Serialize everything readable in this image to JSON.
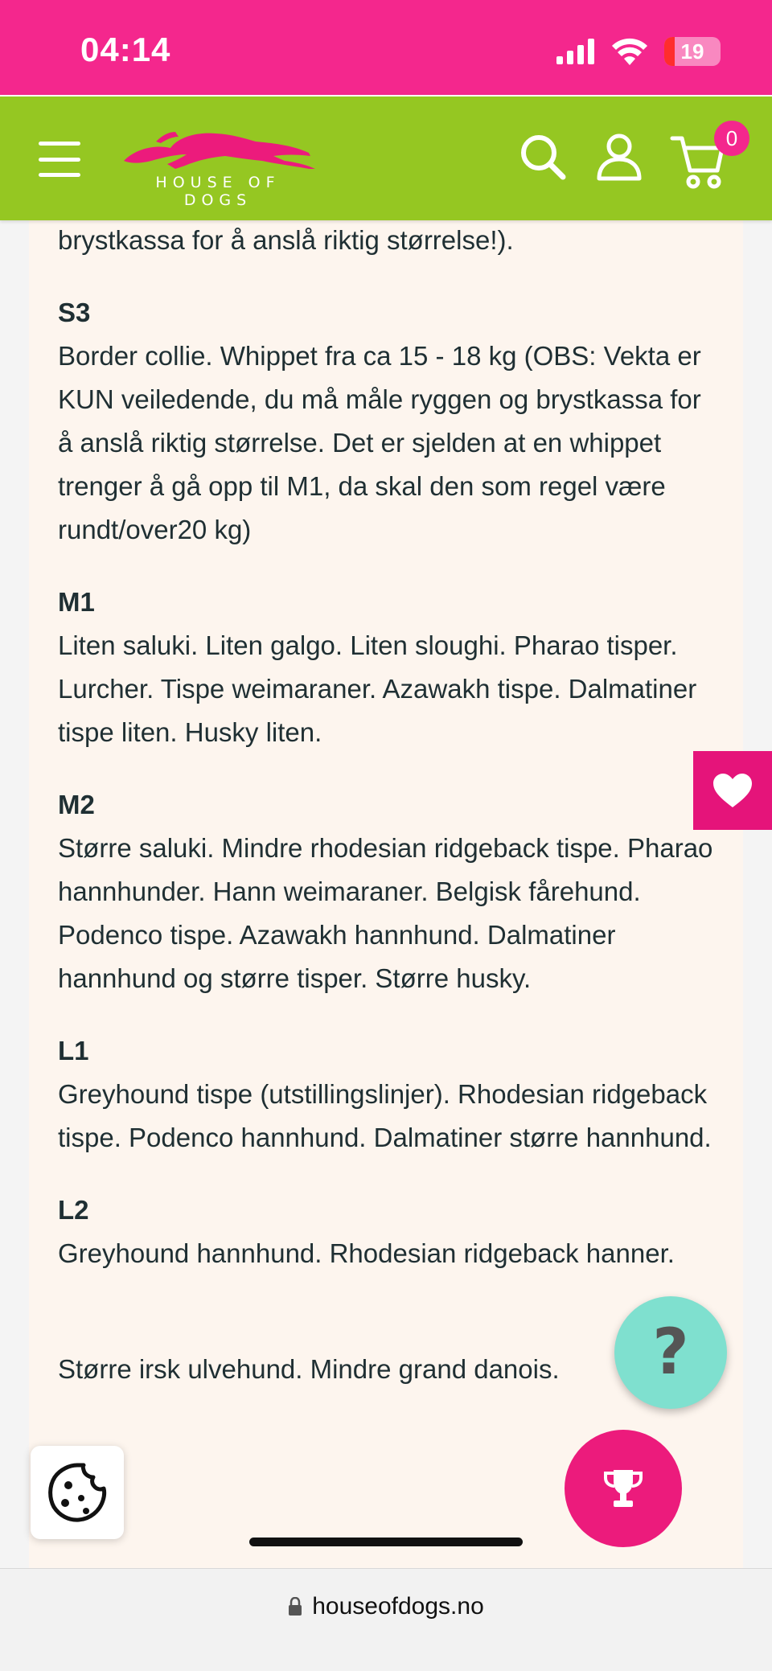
{
  "status_bar": {
    "time": "04:14",
    "battery_level": "19",
    "battery_fraction": 0.19,
    "background_color": "#f4278d"
  },
  "header": {
    "brand": "HOUSE OF DOGS",
    "background_color": "#95c722",
    "cart_count": "0",
    "icons": [
      "menu-icon",
      "search-icon",
      "account-icon",
      "cart-icon"
    ]
  },
  "content": {
    "top_fragment": "brystkassa for å anslå riktig størrelse!).",
    "sizes": [
      {
        "label": "S3",
        "text": "Border collie. Whippet fra ca 15 - 18 kg (OBS: Vekta er KUN veiledende, du må måle ryggen og brystkassa for å anslå riktig størrelse. Det er sjelden at en whippet trenger å gå opp til M1, da skal den som regel være rundt/over20 kg)"
      },
      {
        "label": "M1",
        "text": "Liten saluki. Liten galgo. Liten sloughi. Pharao tisper. Lurcher. Tispe weimaraner.  Azawakh tispe. Dalmatiner tispe liten. Husky liten."
      },
      {
        "label": "M2",
        "text": "Større saluki. Mindre rhodesian ridgeback tispe. Pharao hannhunder. Hann weimaraner.  Belgisk fårehund. Podenco tispe. Azawakh hannhund. Dalmatiner hannhund og større tisper. Større husky."
      },
      {
        "label": "L1",
        "text": "Greyhound tispe (utstillingslinjer). Rhodesian ridgeback tispe. Podenco hannhund. Dalmatiner større hannhund."
      },
      {
        "label": "L2",
        "text": "Greyhound hannhund. Rhodesian ridgeback hanner."
      }
    ],
    "partial_line": "Større irsk ulvehund. Mindre grand danois."
  },
  "floating": {
    "help_label": "?",
    "icons": [
      "heart-icon",
      "trophy-icon",
      "cookie-icon"
    ]
  },
  "browser": {
    "url": "houseofdogs.no"
  }
}
